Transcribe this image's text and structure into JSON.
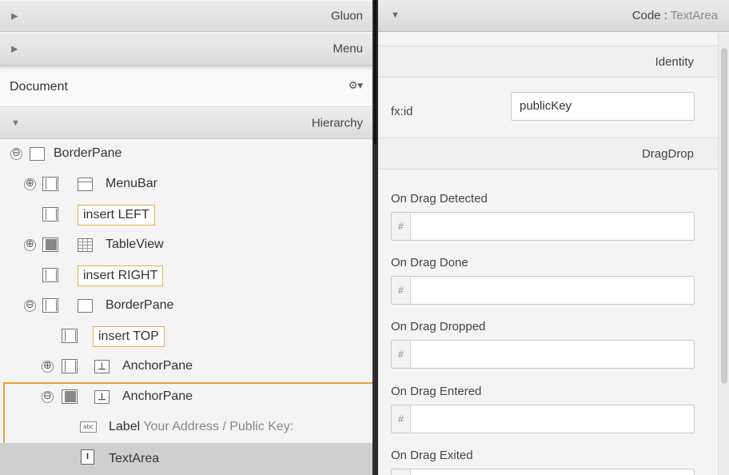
{
  "left_panel": {
    "sections": {
      "gluon": "Gluon",
      "menu": "Menu",
      "document": "Document",
      "document_gear": "⚙▾",
      "hierarchy": "Hierarchy"
    },
    "tree": {
      "root": "BorderPane",
      "menubar": "MenuBar",
      "insert_left": "insert LEFT",
      "tableview": "TableView",
      "insert_right": "insert RIGHT",
      "inner_borderpane": "BorderPane",
      "insert_top": "insert TOP",
      "anchorpane_1": "AnchorPane",
      "anchorpane_2": "AnchorPane",
      "label_type": "Label",
      "label_text": "Your Address / Public Key:",
      "textarea": "TextArea"
    },
    "expanders": {
      "collapse": "⊖",
      "expand": "⊕"
    }
  },
  "right_panel": {
    "header": {
      "title": "Code : ",
      "subtitle": "TextArea"
    },
    "identity": {
      "section": "Identity",
      "fx_id_label": "fx:id",
      "fx_id_value": "publicKey"
    },
    "dragdrop": {
      "section": "DragDrop",
      "fields": [
        {
          "label": "On Drag Detected",
          "prefix": "#",
          "value": ""
        },
        {
          "label": "On Drag Done",
          "prefix": "#",
          "value": ""
        },
        {
          "label": "On Drag Dropped",
          "prefix": "#",
          "value": ""
        },
        {
          "label": "On Drag Entered",
          "prefix": "#",
          "value": ""
        },
        {
          "label": "On Drag Exited",
          "prefix": "#",
          "value": ""
        }
      ]
    }
  }
}
